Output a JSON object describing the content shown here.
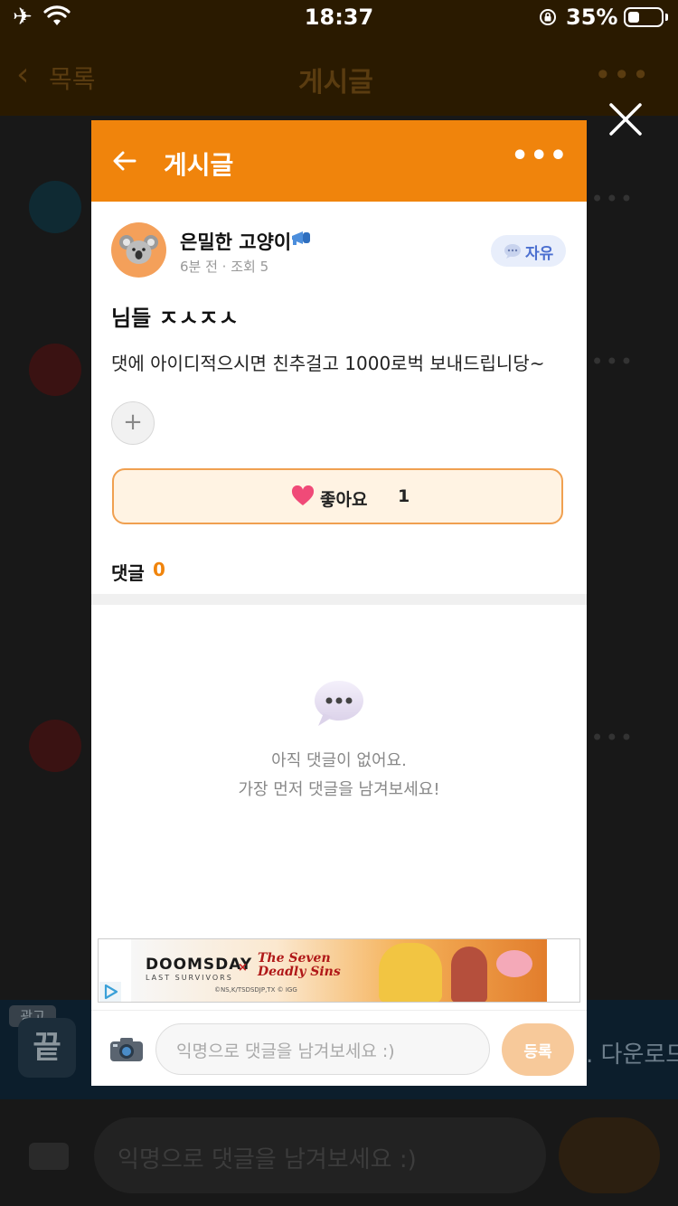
{
  "status_bar": {
    "time": "18:37",
    "battery": "35%"
  },
  "background_app": {
    "back_label": "목록",
    "title": "게시글",
    "ad_badge": "광고",
    "banner_icon_text": "끝",
    "banner_text": ". 다운로드",
    "comment_placeholder": "익명으로 댓글을 남겨보세요 :)"
  },
  "modal": {
    "header": {
      "title": "게시글"
    },
    "post": {
      "author": "은밀한 고양이",
      "meta": "6분 전 · 조회 5",
      "tag": "자유",
      "title": "님들 ㅈㅅㅈㅅ",
      "body": "댓에 아이디적으시면 친추걸고 1000로벅 보내드립니당~"
    },
    "like": {
      "label": "좋아요",
      "count": "1"
    },
    "comments": {
      "label": "댓글",
      "count": "0",
      "empty_line1": "아직 댓글이 없어요.",
      "empty_line2": "가장 먼저 댓글을 남겨보세요!"
    },
    "ad": {
      "logo_main": "DOOMSDAY",
      "logo_sub": "LAST SURVIVORS",
      "cross": "×",
      "logo2_line1": "The Seven",
      "logo2_line2": "Deadly Sins",
      "fine_print": "©NS,K/TSDSDJP,TX © IGG"
    },
    "input": {
      "placeholder": "익명으로 댓글을 남겨보세요 :)",
      "submit": "등록"
    }
  },
  "colors": {
    "accent": "#f0840c",
    "tag_bg": "#e8eefb",
    "tag_text": "#4b6fd0",
    "like_bg": "#fff3e3"
  }
}
